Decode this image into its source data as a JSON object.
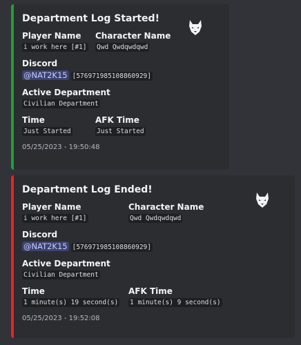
{
  "embeds": [
    {
      "title": "Department Log Started!",
      "player_name_label": "Player Name",
      "player_name_value": "i work here [#1]",
      "character_name_label": "Character Name",
      "character_name_value": "Qwd Qwdqwdqwd",
      "discord_label": "Discord",
      "discord_mention": "@NAT2K15",
      "discord_id": "[576971985108860929]",
      "active_department_label": "Active Department",
      "active_department_value": "Civilian Department",
      "time_label": "Time",
      "time_value": "Just Started",
      "afk_time_label": "AFK Time",
      "afk_time_value": "Just Started",
      "footer": "05/25/2023 - 19:50:48",
      "accent_color": "#22a035",
      "thumbnail_icon": "wolf-logo-icon"
    },
    {
      "title": "Department Log Ended!",
      "player_name_label": "Player Name",
      "player_name_value": "i work here [#1]",
      "character_name_label": "Character Name",
      "character_name_value": "Qwd Qwdqwdqwd",
      "discord_label": "Discord",
      "discord_mention": "@NAT2K15",
      "discord_id": "[576971985108860929]",
      "active_department_label": "Active Department",
      "active_department_value": "Civilian Department",
      "time_label": "Time",
      "time_value": "1 minute(s) 19 second(s)",
      "afk_time_label": "AFK Time",
      "afk_time_value": "1 minute(s) 9 second(s)",
      "footer": "05/25/2023 - 19:52:08",
      "accent_color": "#e3262d",
      "thumbnail_icon": "wolf-logo-icon"
    }
  ]
}
